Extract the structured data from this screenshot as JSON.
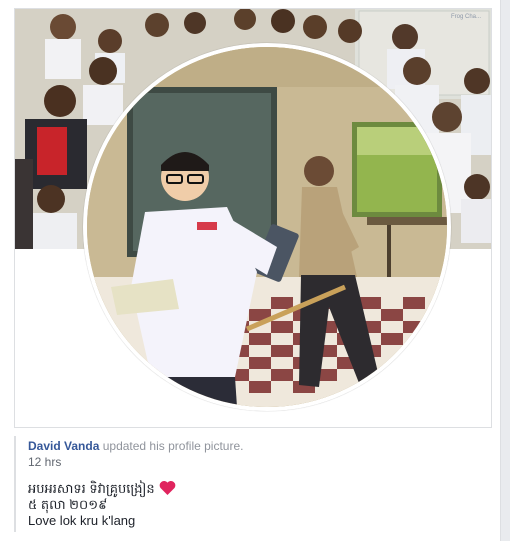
{
  "post": {
    "author_name": "David Vanda",
    "action_text": "updated his profile picture.",
    "timestamp": "12 hrs",
    "caption_line1": "អបអរសាទរ ទិវាគ្រូបង្រៀន",
    "caption_line2": "៥ តុលា ២០១៩",
    "caption_line3": "Love lok kru k'lang",
    "heart_icon": "red-heart-icon"
  },
  "photo": {
    "banner_text": "Frog Cha..."
  },
  "colors": {
    "author_link": "#365899",
    "heart": "#e0245e",
    "border": "#dddfe2"
  }
}
